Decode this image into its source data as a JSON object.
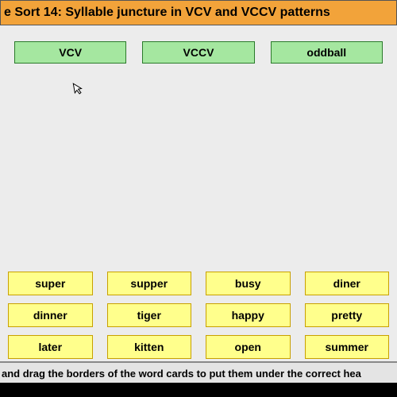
{
  "title": "e Sort 14: Syllable juncture in VCV and VCCV patterns",
  "categories": [
    {
      "label": "VCV"
    },
    {
      "label": "VCCV"
    },
    {
      "label": "oddball"
    }
  ],
  "words": [
    "super",
    "supper",
    "busy",
    "diner",
    "dinner",
    "tiger",
    "happy",
    "pretty",
    "later",
    "kitten",
    "open",
    "summer"
  ],
  "instruction": "and drag the borders of the word cards to put them under the correct hea"
}
